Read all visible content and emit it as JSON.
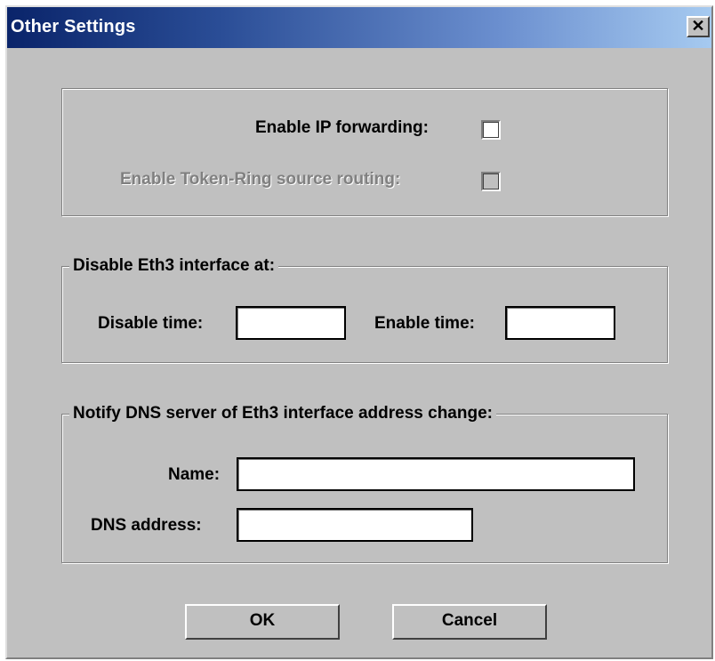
{
  "window": {
    "title": "Other Settings",
    "close_symbol": "✕"
  },
  "routing": {
    "ip_forwarding_label": "Enable IP forwarding:",
    "ip_forwarding_checked": false,
    "token_ring_label": "Enable Token-Ring source routing:",
    "token_ring_checked": false,
    "token_ring_enabled": false
  },
  "disable_group": {
    "legend": "Disable Eth3 interface at:",
    "disable_time_label": "Disable time:",
    "disable_time_value": "",
    "enable_time_label": "Enable time:",
    "enable_time_value": ""
  },
  "dns_group": {
    "legend": "Notify DNS server of Eth3 interface address change:",
    "name_label": "Name:",
    "name_value": "",
    "dns_address_label": "DNS address:",
    "dns_address_value": ""
  },
  "buttons": {
    "ok_label": "OK",
    "cancel_label": "Cancel"
  },
  "icons": {
    "close": "close-icon"
  },
  "colors": {
    "title_bar_start": "#0a246a",
    "title_bar_end": "#a6caf0",
    "dialog_face": "#c0c0c0"
  }
}
